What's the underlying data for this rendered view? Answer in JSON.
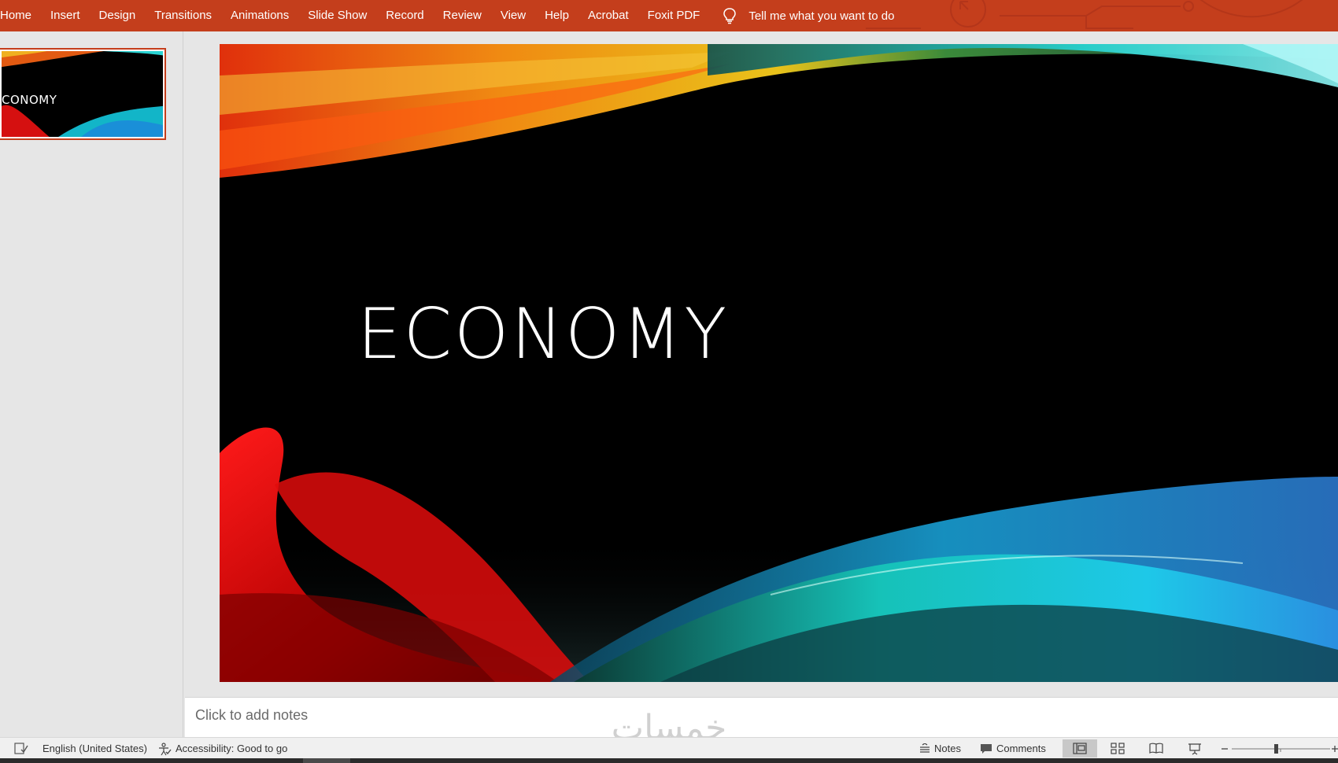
{
  "ribbon": {
    "tabs": [
      "Home",
      "Insert",
      "Design",
      "Transitions",
      "Animations",
      "Slide Show",
      "Record",
      "Review",
      "View",
      "Help",
      "Acrobat",
      "Foxit PDF"
    ],
    "tell_me": "Tell me what you want to do",
    "accent_color": "#c43e1c"
  },
  "thumbnails": [
    {
      "title": "CONOMY"
    }
  ],
  "slide": {
    "title": "ECONOMY"
  },
  "notes": {
    "placeholder": "Click to add notes"
  },
  "watermark": {
    "text": "خمسات"
  },
  "status_bar": {
    "language": "English (United States)",
    "accessibility": "Accessibility: Good to go",
    "notes_label": "Notes",
    "comments_label": "Comments"
  }
}
